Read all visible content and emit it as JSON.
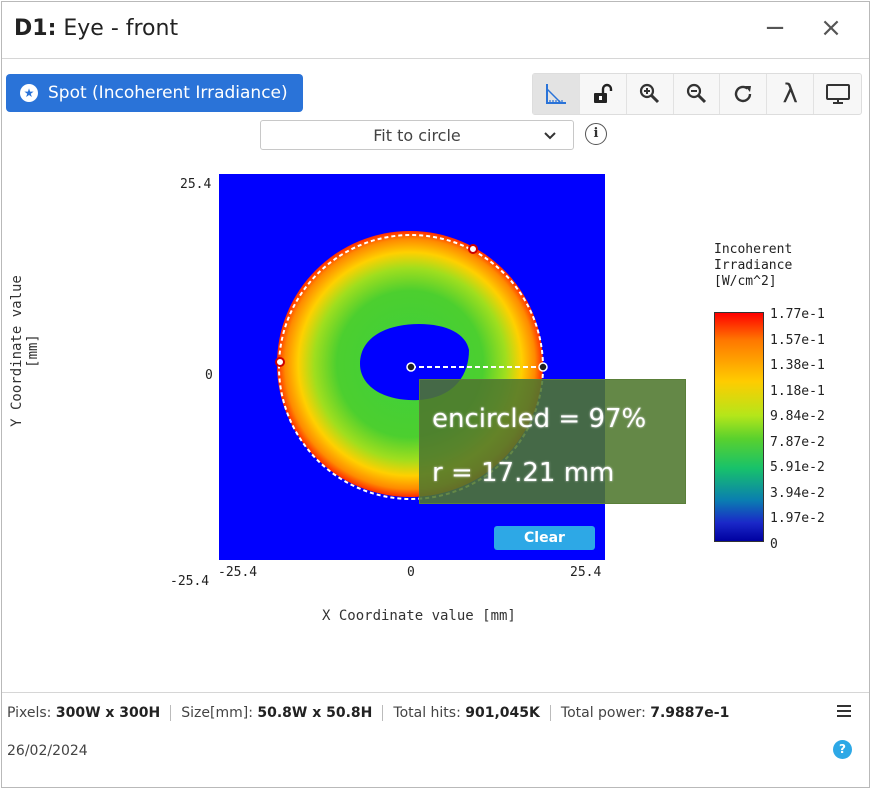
{
  "window": {
    "title_id": "D1:",
    "title_name": "Eye - front",
    "minimize_glyph": "−",
    "close_glyph": "×"
  },
  "spot_button": {
    "label": "Spot (Incoherent Irradiance)",
    "icon": "star-circle-icon"
  },
  "toolbar": {
    "tools": [
      "axes-icon",
      "unlock-icon",
      "zoom-in-icon",
      "zoom-out-icon",
      "refresh-icon",
      "lambda-icon",
      "monitor-icon"
    ],
    "lambda_glyph": "λ"
  },
  "fit_select": {
    "value": "Fit to circle"
  },
  "info_glyph": "i",
  "plot": {
    "xlabel": "X Coordinate value [mm]",
    "ylabel": "Y Coordinate value [mm]",
    "x_ticks": [
      "-25.4",
      "0",
      "25.4"
    ],
    "y_ticks": [
      "25.4",
      "0",
      "-25.4"
    ],
    "xlim": [
      -25.4,
      25.4
    ],
    "ylim": [
      -25.4,
      25.4
    ]
  },
  "overlay": {
    "encircled": "encircled = 97%",
    "radius": "r = 17.21 mm",
    "clear_label": "Clear",
    "encircled_percent": 97,
    "r_mm": 17.21
  },
  "colorbar": {
    "title_lines": [
      "Incoherent",
      "Irradiance",
      "[W/cm^2]"
    ],
    "ticks": [
      "1.77e-1",
      "1.57e-1",
      "1.38e-1",
      "1.18e-1",
      "9.84e-2",
      "7.87e-2",
      "5.91e-2",
      "3.94e-2",
      "1.97e-2",
      "0"
    ]
  },
  "footer": {
    "stats": [
      {
        "label": "Pixels:",
        "value": "300W x 300H"
      },
      {
        "label": "Size[mm]:",
        "value": "50.8W x 50.8H"
      },
      {
        "label": "Total hits:",
        "value": "901,045K"
      },
      {
        "label": "Total power:",
        "value": "7.9887e-1"
      }
    ],
    "date": "26/02/2024",
    "help_glyph": "?"
  },
  "colors": {
    "accent": "#2a73d8",
    "clear_button": "#2da8e6",
    "plot_background": "#0000ff"
  }
}
